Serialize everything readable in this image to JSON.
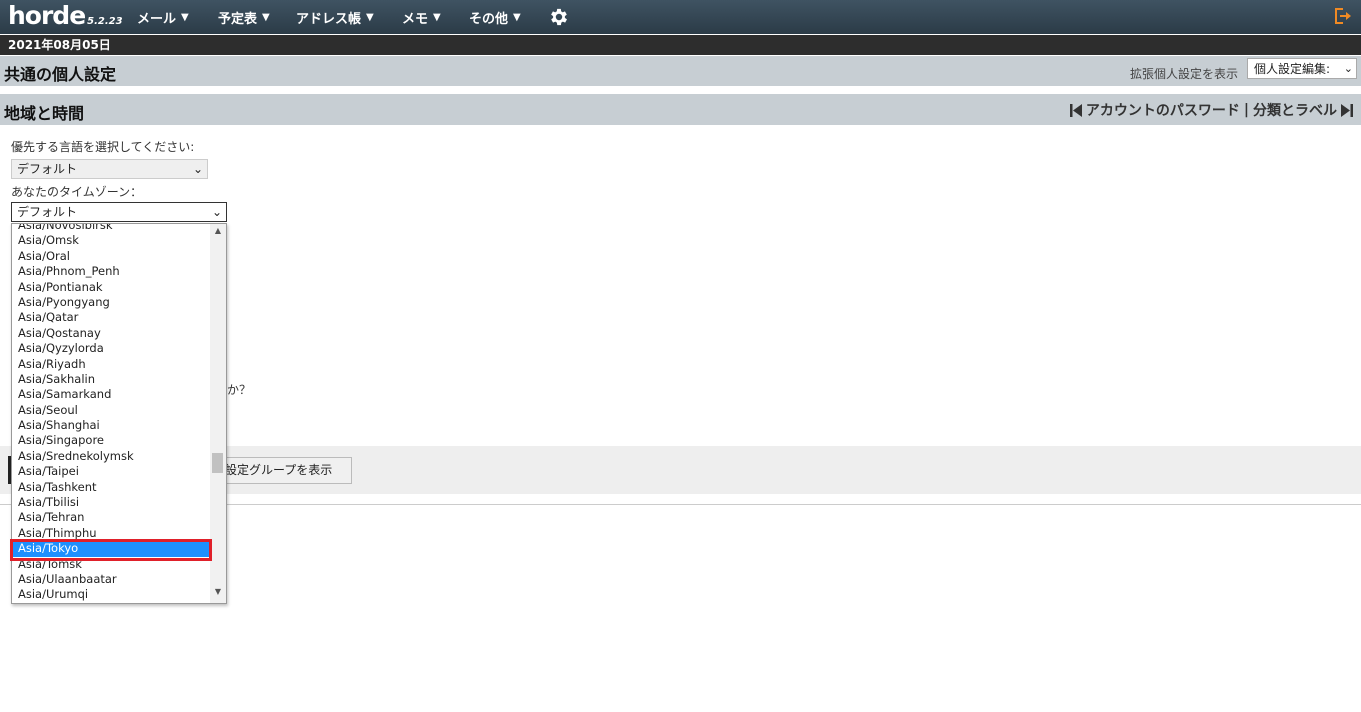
{
  "header": {
    "logo": "horde",
    "version": "5.2.23",
    "nav": [
      {
        "label": "メール"
      },
      {
        "label": "予定表"
      },
      {
        "label": "アドレス帳"
      },
      {
        "label": "メモ"
      },
      {
        "label": "その他"
      }
    ],
    "date": "2021年08月05日"
  },
  "page": {
    "title": "共通の個人設定",
    "advanced_link": "拡張個人設定を表示",
    "pref_select_value": "個人設定編集:"
  },
  "section": {
    "title": "地域と時間",
    "prev_link": "アカウントのパスワード",
    "separator": "|",
    "next_link": "分類とラベル"
  },
  "form": {
    "language_label": "優先する言語を選択してください:",
    "language_value": "デフォルト",
    "timezone_label": "あなたのタイムゾーン：",
    "timezone_value": "デフォルト",
    "hidden_text_fragment": "か？",
    "button_fragment": "設定グループを表示"
  },
  "timezone_options": [
    "Asia/Novosibirsk",
    "Asia/Omsk",
    "Asia/Oral",
    "Asia/Phnom_Penh",
    "Asia/Pontianak",
    "Asia/Pyongyang",
    "Asia/Qatar",
    "Asia/Qostanay",
    "Asia/Qyzylorda",
    "Asia/Riyadh",
    "Asia/Sakhalin",
    "Asia/Samarkand",
    "Asia/Seoul",
    "Asia/Shanghai",
    "Asia/Singapore",
    "Asia/Srednekolymsk",
    "Asia/Taipei",
    "Asia/Tashkent",
    "Asia/Tbilisi",
    "Asia/Tehran",
    "Asia/Thimphu",
    "Asia/Tokyo",
    "Asia/Tomsk",
    "Asia/Ulaanbaatar",
    "Asia/Urumqi"
  ],
  "selected_option": "Asia/Tokyo",
  "colors": {
    "topbar": "#33444f",
    "band": "#c7ced3",
    "selection": "#1e90ff",
    "highlight": "#e0202a",
    "logout_icon": "#f08a24"
  },
  "icons": {
    "settings": "gear-icon",
    "logout": "logout-icon",
    "prev": "first-page-icon",
    "next": "last-page-icon"
  }
}
